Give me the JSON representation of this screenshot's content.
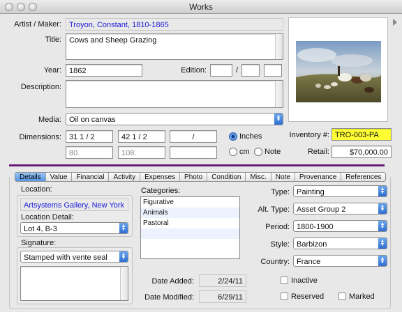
{
  "window": {
    "title": "Works"
  },
  "artwork": {
    "artist_label": "Artist / Maker:",
    "artist": "Troyon, Constant, 1810-1865",
    "title_label": "Title:",
    "title": "Cows and Sheep Grazing",
    "year_label": "Year:",
    "year": "1862",
    "edition_label": "Edition:",
    "edition_sep": "/",
    "description_label": "Description:",
    "media_label": "Media:",
    "media": "Oil on canvas",
    "dimensions_label": "Dimensions:",
    "dim1": "31    1 / 2",
    "dim2": "42    1 / 2",
    "dim3": "/",
    "dim1_metric": "80.",
    "dim2_metric": "108.",
    "units": {
      "inches": "Inches",
      "cm": "cm",
      "note": "Note"
    },
    "inventory_label": "Inventory #:",
    "inventory": "TRO-003-PA",
    "retail_label": "Retail:",
    "retail": "$70,000.00"
  },
  "tabs": [
    "Details",
    "Value",
    "Financial",
    "Activity",
    "Expenses",
    "Photo",
    "Condition",
    "Misc.",
    "Note",
    "Provenance",
    "References"
  ],
  "details": {
    "location_label": "Location:",
    "location": "Artsystems Gallery, New York",
    "location_detail_label": "Location Detail:",
    "location_detail": "Lot 4, B-3",
    "signature_label": "Signature:",
    "signature": "Stamped with vente seal",
    "categories_label": "Categories:",
    "categories": [
      "Figurative",
      "Animals",
      "Pastoral"
    ],
    "type_label": "Type:",
    "type": "Painting",
    "alt_type_label": "Alt. Type:",
    "alt_type": "Asset Group 2",
    "period_label": "Period:",
    "period": "1800-1900",
    "style_label": "Style:",
    "style": "Barbizon",
    "country_label": "Country:",
    "country": "France",
    "date_added_label": "Date Added:",
    "date_added": "2/24/11",
    "date_modified_label": "Date Modified:",
    "date_modified": "6/29/11",
    "inactive_label": "Inactive",
    "reserved_label": "Reserved",
    "marked_label": "Marked"
  }
}
